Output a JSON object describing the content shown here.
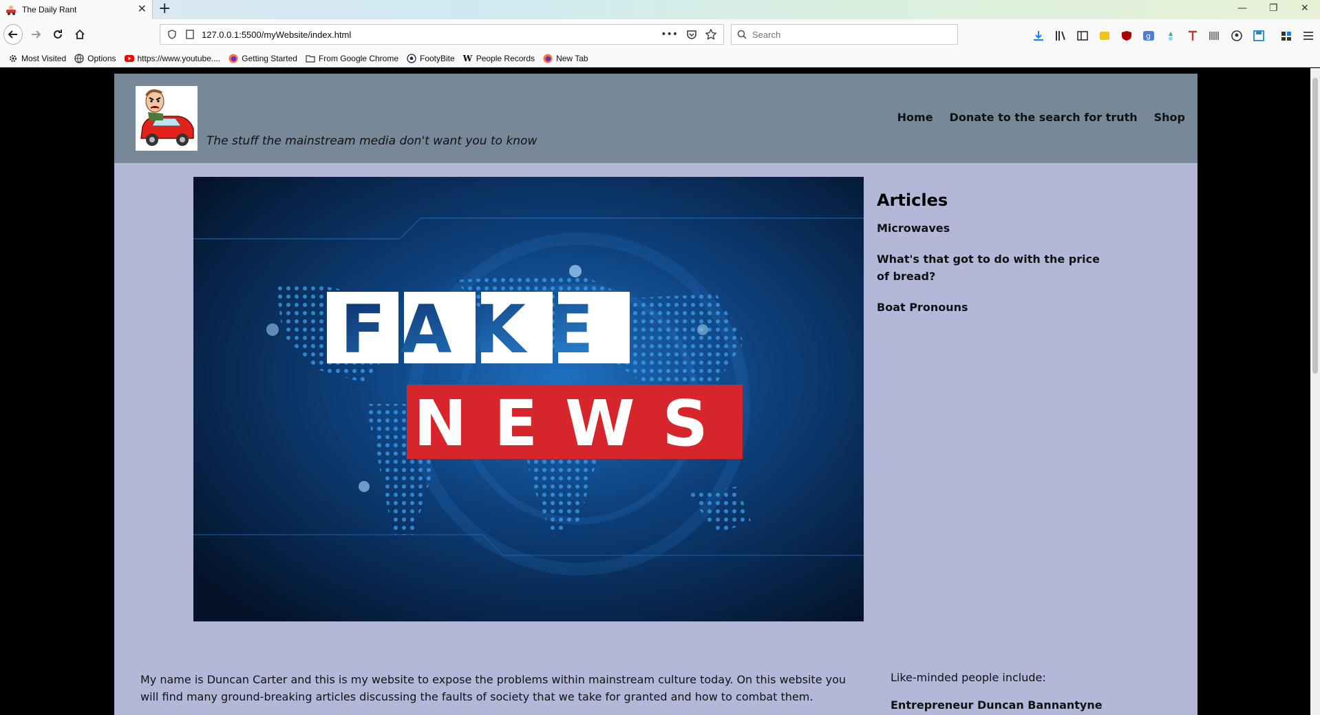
{
  "browser": {
    "tab_title": "The Daily Rant",
    "url": "127.0.0.1:5500/myWebsite/index.html",
    "search_placeholder": "Search",
    "bookmarks": [
      {
        "label": "Most Visited",
        "icon": "gear-icon"
      },
      {
        "label": "Options",
        "icon": "globe-icon"
      },
      {
        "label": "https://www.youtube....",
        "icon": "youtube-icon"
      },
      {
        "label": "Getting Started",
        "icon": "firefox-icon"
      },
      {
        "label": "From Google Chrome",
        "icon": "folder-icon"
      },
      {
        "label": "FootyBite",
        "icon": "football-icon"
      },
      {
        "label": "People Records",
        "icon": "wikipedia-icon"
      },
      {
        "label": "New Tab",
        "icon": "firefox-icon"
      }
    ]
  },
  "site": {
    "tagline": "The stuff the mainstream media don't want you to know",
    "nav": [
      "Home",
      "Donate to the search for truth",
      "Shop"
    ],
    "hero": {
      "line1": "FAKE",
      "line2": "NEWS"
    },
    "articles": {
      "heading": "Articles",
      "items": [
        "Microwaves",
        "What's that got to do with the price of bread?",
        "Boat Pronouns"
      ]
    },
    "intro": "My name is Duncan Carter and this is my website to expose the problems within mainstream culture today. On this website you will find many ground-breaking articles discussing the faults of society that we take for granted and how to combat them.",
    "like_minded_label": "Like-minded people include:",
    "like_minded_first": "Entrepreneur Duncan Bannantyne"
  },
  "colors": {
    "page_bg": "#b3b8d8",
    "header_bg": "#778899",
    "news_red": "#d6262b"
  }
}
